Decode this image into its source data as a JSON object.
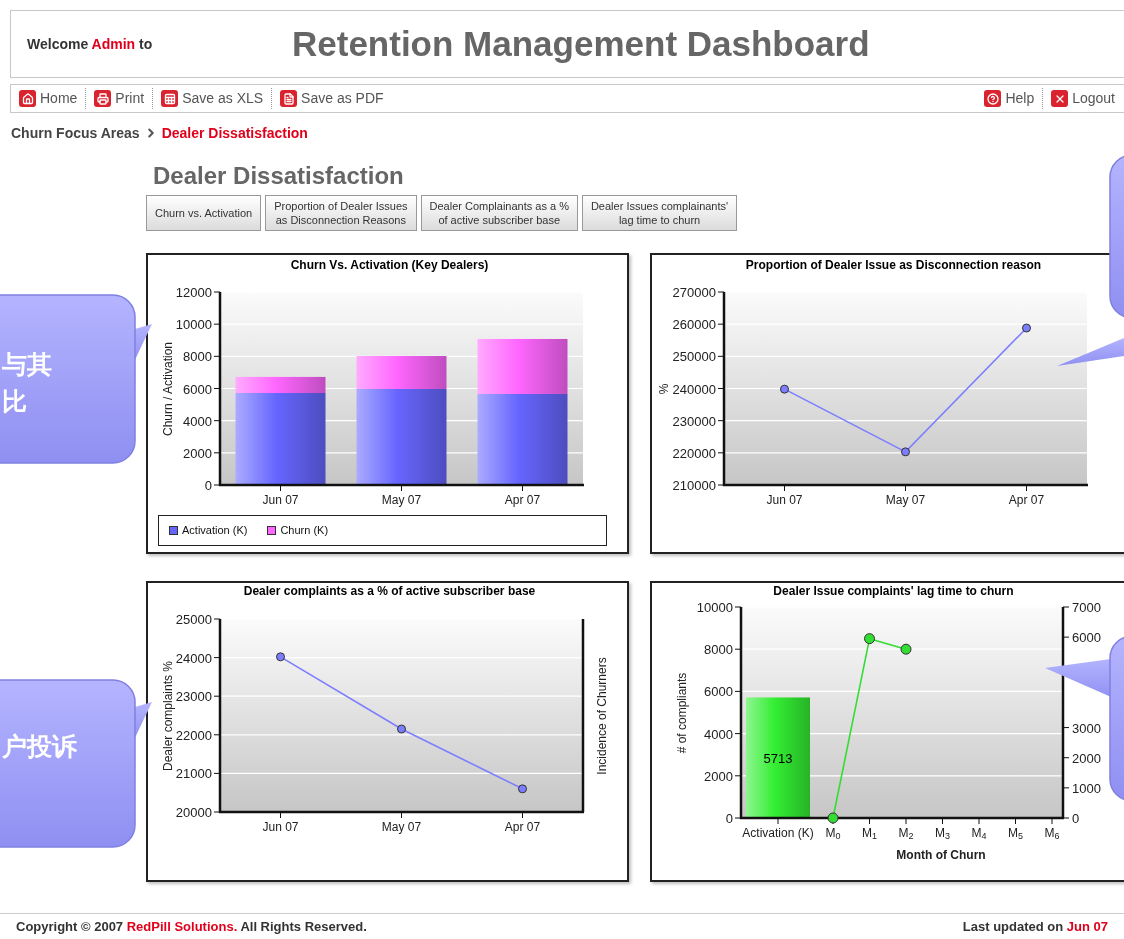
{
  "header": {
    "welcome": {
      "prefix": "Welcome",
      "user": "Admin",
      "suffix": "to"
    },
    "title": "Retention Management Dashboard"
  },
  "toolbar": {
    "left": [
      {
        "label": "Home",
        "kind": "home"
      },
      {
        "label": "Print",
        "kind": "print"
      },
      {
        "label": "Save as XLS",
        "kind": "xls"
      },
      {
        "label": "Save as PDF",
        "kind": "pdf"
      }
    ],
    "right": [
      {
        "label": "Help",
        "kind": "help"
      },
      {
        "label": "Logout",
        "kind": "logout"
      }
    ]
  },
  "breadcrumb": {
    "parent": "Churn Focus Areas",
    "current": "Dealer Dissatisfaction"
  },
  "page_title": "Dealer Dissatisfaction",
  "tabs": [
    {
      "lines": [
        "Churn vs. Activation"
      ],
      "selected": false
    },
    {
      "lines": [
        "Proportion of Dealer Issues",
        "as Disconnection Reasons"
      ],
      "selected": false
    },
    {
      "lines": [
        "Dealer Complainants as a %",
        "of active subscriber base"
      ],
      "selected": false
    },
    {
      "lines": [
        "Dealer Issues complainants'",
        "lag time to churn"
      ],
      "selected": false
    }
  ],
  "charts": [
    {
      "chart_data": {
        "type": "bar",
        "title": "Churn Vs. Activation (Key Dealers)",
        "ylabel": "Churn / Activation",
        "categories": [
          "Jun 07",
          "May 07",
          "Apr 07"
        ],
        "stacked": true,
        "grid": true,
        "legend": "bottom",
        "ylim": [
          0,
          12000
        ],
        "yticks": [
          0,
          2000,
          4000,
          6000,
          8000,
          10000,
          12000
        ],
        "series": [
          {
            "name": "Activation (K)",
            "color": "#6666ff",
            "values": [
              5720,
              5970,
              5660
            ]
          },
          {
            "name": "Churn (K)",
            "color": "#ff66ff",
            "values": [
              1000,
              2050,
              3420
            ]
          }
        ]
      }
    },
    {
      "chart_data": {
        "type": "line",
        "title": "Proportion of Dealer Issue as Disconnection reason",
        "ylabel": "%",
        "categories": [
          "Jun 07",
          "May 07",
          "Apr 07"
        ],
        "grid": true,
        "ylim": [
          210000,
          270000
        ],
        "yticks": [
          210000,
          220000,
          230000,
          240000,
          250000,
          260000,
          270000
        ],
        "series": [
          {
            "color": "#7d7dff",
            "marker": "circle",
            "values": [
              239800,
              220300,
              258800
            ]
          }
        ]
      }
    },
    {
      "chart_data": {
        "type": "line",
        "title": "Dealer complaints as a % of active subscriber base",
        "ylabel": "Dealer complaints %",
        "y2label": "Incidence of Churners",
        "categories": [
          "Jun 07",
          "May 07",
          "Apr 07"
        ],
        "grid": true,
        "ylim": [
          20000,
          25000
        ],
        "yticks": [
          20000,
          21000,
          22000,
          23000,
          24000,
          25000
        ],
        "series": [
          {
            "color": "#7d7dff",
            "marker": "circle",
            "values": [
              24020,
              22150,
              20600
            ]
          }
        ]
      }
    },
    {
      "chart_data": {
        "type": "bar",
        "title": "Dealer Issue complaints' lag time to churn",
        "xlabel": "Month of Churn",
        "ylabel": "# of compliants",
        "categories": [
          "Activation (K)",
          "M$_{0}$",
          "M$_{1}$",
          "M$_{2}$",
          "M$_{3}$",
          "M$_{4}$",
          "M$_{5}$",
          "M$_{6}$"
        ],
        "ylim": [
          0,
          10000
        ],
        "yticks": [
          0,
          2000,
          4000,
          6000,
          8000,
          10000
        ],
        "y2lim": [
          0,
          7000
        ],
        "y2ticks": [
          0,
          1000,
          2000,
          3000,
          6000,
          7000
        ],
        "grid": true,
        "series": [
          {
            "type": "bar",
            "color": "#33ee33",
            "values": [
              5713,
              null,
              null,
              null,
              null,
              null,
              null,
              null
            ],
            "value_labels": [
              "5713",
              null,
              null,
              null,
              null,
              null,
              null,
              null
            ]
          },
          {
            "type": "line",
            "color": "#33dd33",
            "marker": "circle",
            "values": [
              null,
              0,
              8500,
              8000,
              null,
              null,
              null,
              null
            ]
          }
        ]
      }
    }
  ],
  "callouts": [
    {
      "kind": "left",
      "lines": [
        "与其",
        "比"
      ]
    },
    {
      "kind": "left",
      "lines": [
        "户投诉"
      ]
    },
    {
      "kind": "right"
    },
    {
      "kind": "right"
    }
  ],
  "footer": {
    "copyright": {
      "prefix": "Copyright © 2007",
      "link": "RedPill Solutions.",
      "suffix": "All Rights Reserved."
    },
    "updated": {
      "prefix": "Last updated on",
      "date": "Jun 07"
    }
  }
}
